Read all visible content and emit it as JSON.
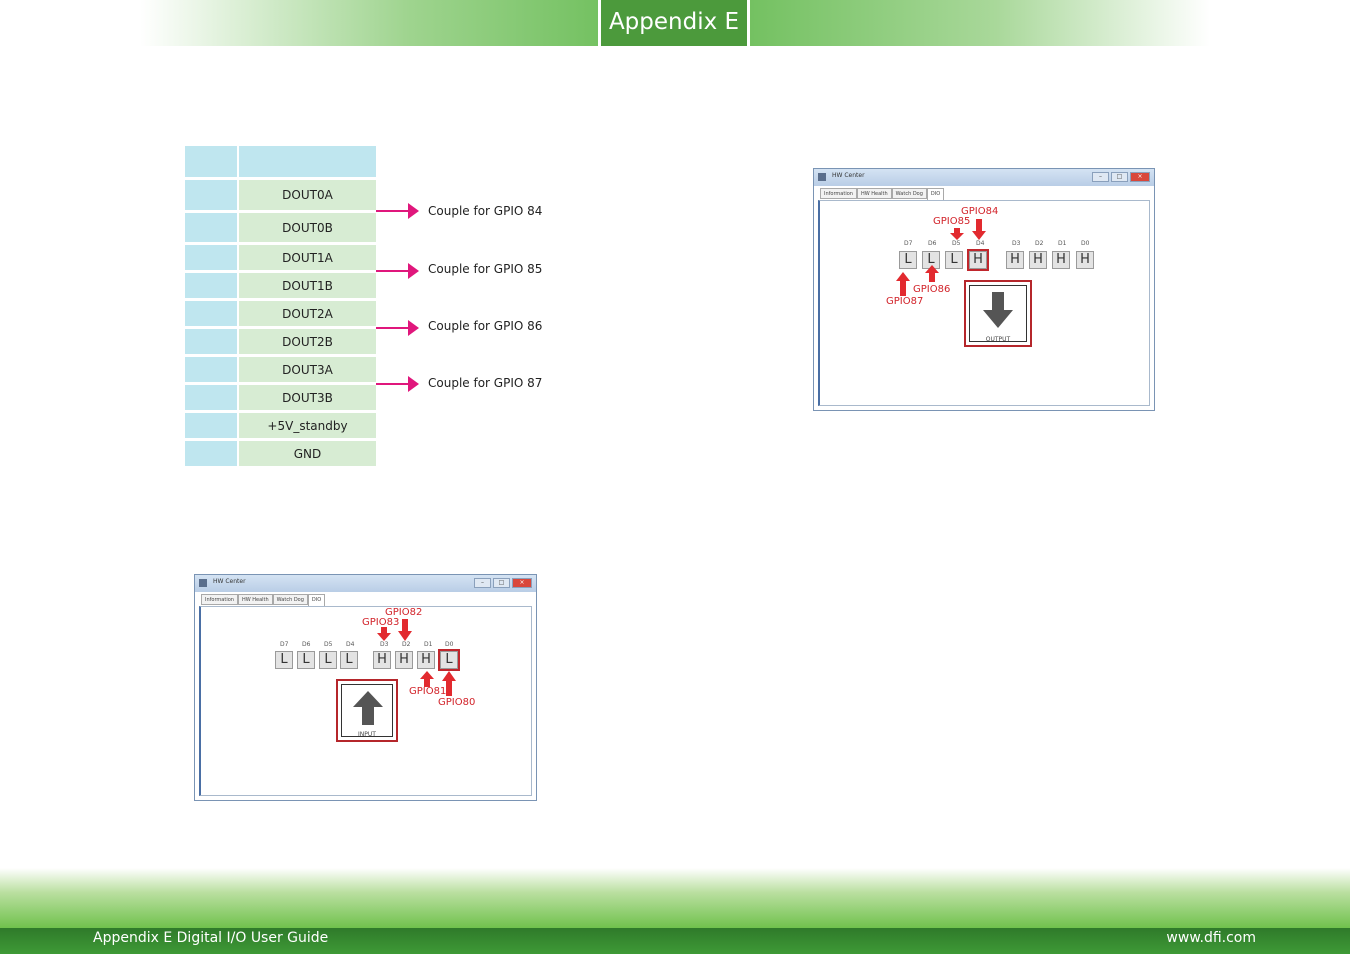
{
  "header": {
    "title": "Appendix E"
  },
  "table": {
    "rows": [
      "",
      "DOUT0A",
      "DOUT0B",
      "DOUT1A",
      "DOUT1B",
      "DOUT2A",
      "DOUT2B",
      "DOUT3A",
      "DOUT3B",
      "+5V_standby",
      "GND"
    ]
  },
  "couples": [
    "Couple for GPIO 84",
    "Couple for GPIO 85",
    "Couple for GPIO 86",
    "Couple for GPIO 87"
  ],
  "window_output": {
    "title": "HW Center",
    "tabs": [
      "Information",
      "HW Health",
      "Watch Dog",
      "DIO"
    ],
    "bit_labels": [
      "D7",
      "D6",
      "D5",
      "D4",
      "D3",
      "D2",
      "D1",
      "D0"
    ],
    "bits": [
      "L",
      "L",
      "L",
      "H",
      "H",
      "H",
      "H",
      "H"
    ],
    "gpio_labels": [
      "GPIO84",
      "GPIO85",
      "GPIO86",
      "GPIO87"
    ],
    "button_label": "OUTPUT"
  },
  "window_input": {
    "title": "HW Center",
    "tabs": [
      "Information",
      "HW Health",
      "Watch Dog",
      "DIO"
    ],
    "bit_labels": [
      "D7",
      "D6",
      "D5",
      "D4",
      "D3",
      "D2",
      "D1",
      "D0"
    ],
    "bits": [
      "L",
      "L",
      "L",
      "L",
      "H",
      "H",
      "H",
      "L"
    ],
    "gpio_labels": [
      "GPIO82",
      "GPIO83",
      "GPIO81",
      "GPIO80"
    ],
    "button_label": "INPUT"
  },
  "footer": {
    "left": "Appendix E Digital I/O User Guide",
    "right": "www.dfi.com"
  }
}
